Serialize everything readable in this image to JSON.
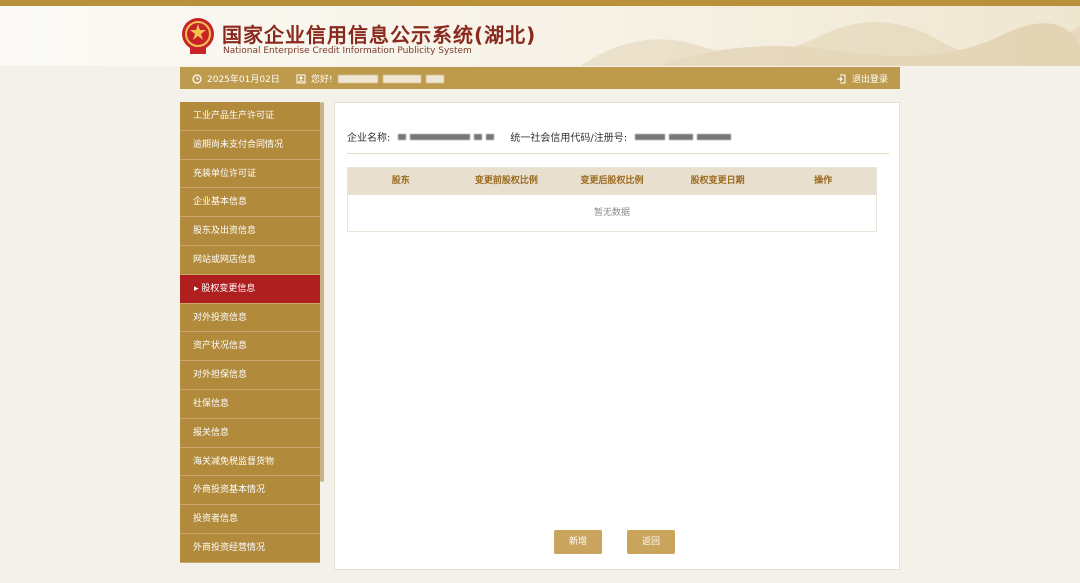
{
  "header": {
    "title_cn": "国家企业信用信息公示系统(湖北)",
    "title_en": "National Enterprise Credit Information Publicity System"
  },
  "navbar": {
    "date": "2025年01月02日",
    "greeting": "您好!",
    "logout": "退出登录"
  },
  "sidebar": {
    "items": [
      {
        "label": "工业产品生产许可证"
      },
      {
        "label": "逾期尚未支付合同情况"
      },
      {
        "label": "充装单位许可证"
      },
      {
        "label": "企业基本信息"
      },
      {
        "label": "股东及出资信息"
      },
      {
        "label": "网站或网店信息"
      },
      {
        "label": "股权变更信息",
        "active": true
      },
      {
        "label": "对外投资信息"
      },
      {
        "label": "资产状况信息"
      },
      {
        "label": "对外担保信息"
      },
      {
        "label": "社保信息"
      },
      {
        "label": "报关信息"
      },
      {
        "label": "海关减免税监督货物"
      },
      {
        "label": "外商投资基本情况"
      },
      {
        "label": "投资者信息"
      },
      {
        "label": "外商投资经营情况"
      }
    ]
  },
  "main": {
    "company_label": "企业名称:",
    "code_label": "统一社会信用代码/注册号:",
    "table": {
      "columns": [
        "股东",
        "变更前股权比例",
        "变更后股权比例",
        "股权变更日期",
        "操作"
      ],
      "empty_text": "暂无数据"
    },
    "buttons": {
      "add": "新增",
      "back": "返回"
    }
  },
  "colors": {
    "accent_gold": "#b18a3c",
    "active_red": "#b01f1f",
    "title_red": "#8a2a1f"
  }
}
